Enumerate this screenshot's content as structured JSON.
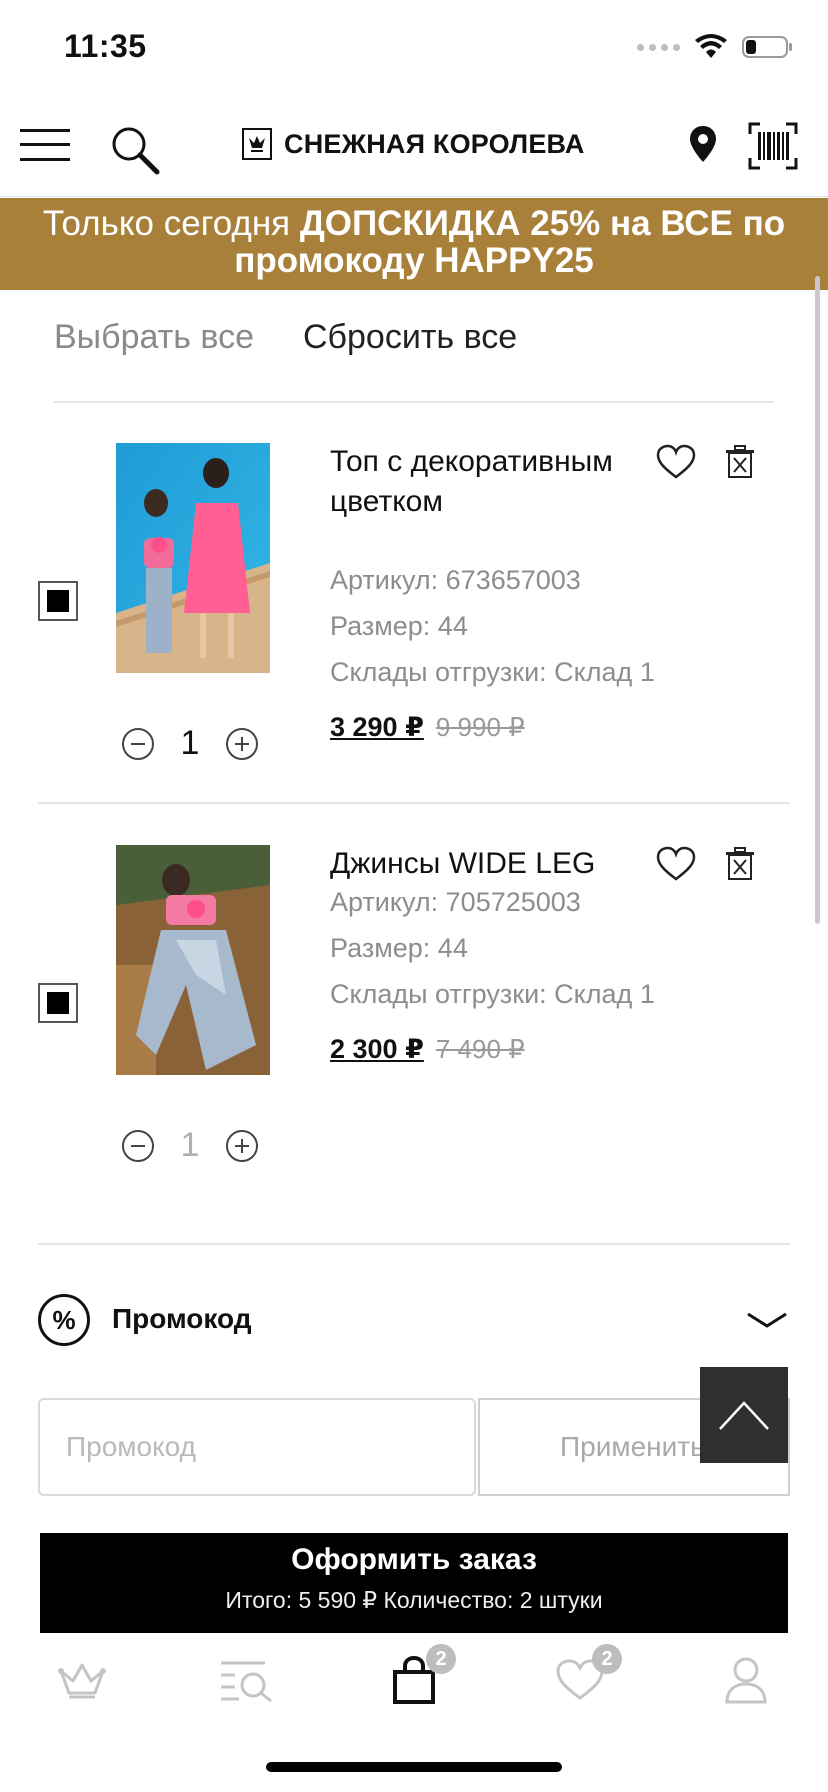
{
  "status_bar": {
    "time": "11:35"
  },
  "header": {
    "brand": "СНЕЖНАЯ КОРОЛЕВА",
    "icons": [
      "menu-icon",
      "search-icon",
      "crown-logo-icon",
      "location-pin-icon",
      "barcode-icon"
    ]
  },
  "banner": {
    "prefix": "Только сегодня ",
    "highlight": "ДОПСКИДКА 25% на ВСЕ по промокоду HAPPY25",
    "background": "#a8803a"
  },
  "cart": {
    "select_all": "Выбрать все",
    "reset_all": "Сбросить все",
    "items": [
      {
        "title": "Топ с декоративным цветком",
        "article": "Артикул: 673657003",
        "size": "Размер: 44",
        "warehouse": "Склады отгрузки: Склад 1",
        "price": "3 290 ₽",
        "old_price": "9 990 ₽",
        "quantity": "1",
        "checked": true
      },
      {
        "title": "Джинсы WIDE LEG",
        "article": "Артикул: 705725003",
        "size": "Размер: 44",
        "warehouse": "Склады отгрузки: Склад 1",
        "price": "2 300 ₽",
        "old_price": "7 490 ₽",
        "quantity": "1",
        "checked": true
      }
    ]
  },
  "promo": {
    "percent_symbol": "%",
    "label": "Промокод",
    "input_placeholder": "Промокод",
    "input_value": "",
    "apply_label": "Применить"
  },
  "checkout": {
    "title": "Оформить заказ",
    "summary": "Итого: 5 590 ₽  Количество: 2 штуки"
  },
  "tabbar": {
    "cart_badge": "2",
    "favorites_badge": "2",
    "active_tab": "cart"
  }
}
